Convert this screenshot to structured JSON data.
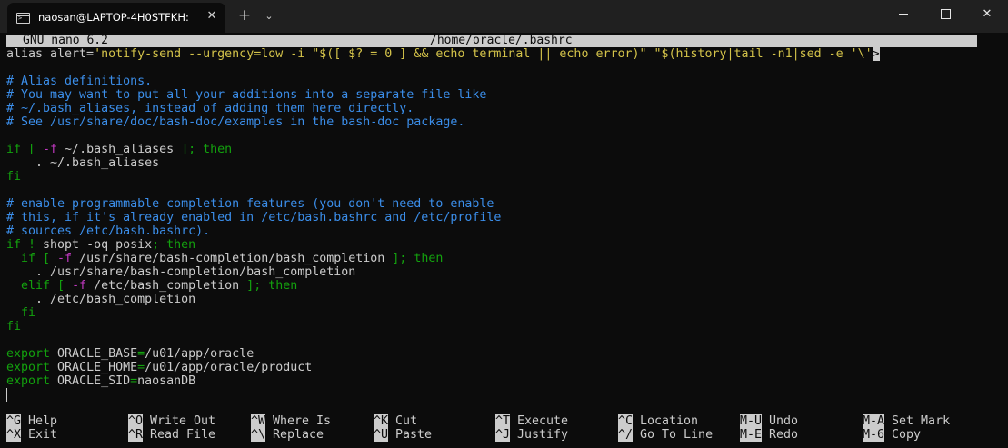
{
  "window": {
    "tab_title": "naosan@LAPTOP-4H0STFKH:",
    "tab_close": "✕",
    "new_tab": "+",
    "dropdown": "⌄",
    "close": "✕"
  },
  "nano": {
    "version": "GNU nano 6.2",
    "file": "/home/oracle/.bashrc",
    "truncation_marker": ">"
  },
  "lines": [
    [
      [
        "w",
        "alias alert="
      ],
      [
        "y",
        "'notify-send --urgency=low -i \"$([ $? = 0 ] && echo terminal || echo error)\" \"$(history|tail -n1|sed -e '\\'"
      ]
    ],
    [],
    [
      [
        "b",
        "# Alias definitions."
      ]
    ],
    [
      [
        "b",
        "# You may want to put all your additions into a separate file like"
      ]
    ],
    [
      [
        "b",
        "# ~/.bash_aliases, instead of adding them here directly."
      ]
    ],
    [
      [
        "b",
        "# See /usr/share/doc/bash-doc/examples in the bash-doc package."
      ]
    ],
    [],
    [
      [
        "g",
        "if [ "
      ],
      [
        "m",
        "-f"
      ],
      [
        "w",
        " ~/.bash_aliases "
      ],
      [
        "g",
        "]; then"
      ]
    ],
    [
      [
        "w",
        "    . ~/.bash_aliases"
      ]
    ],
    [
      [
        "g",
        "fi"
      ]
    ],
    [],
    [
      [
        "b",
        "# enable programmable completion features (you don't need to enable"
      ]
    ],
    [
      [
        "b",
        "# this, if it's already enabled in /etc/bash.bashrc and /etc/profile"
      ]
    ],
    [
      [
        "b",
        "# sources /etc/bash.bashrc)."
      ]
    ],
    [
      [
        "g",
        "if ! "
      ],
      [
        "w",
        "shopt -oq posix"
      ],
      [
        "g",
        "; then"
      ]
    ],
    [
      [
        "g",
        "  if [ "
      ],
      [
        "m",
        "-f"
      ],
      [
        "w",
        " /usr/share/bash-completion/bash_completion "
      ],
      [
        "g",
        "]; then"
      ]
    ],
    [
      [
        "w",
        "    . /usr/share/bash-completion/bash_completion"
      ]
    ],
    [
      [
        "g",
        "  elif [ "
      ],
      [
        "m",
        "-f"
      ],
      [
        "w",
        " /etc/bash_completion "
      ],
      [
        "g",
        "]; then"
      ]
    ],
    [
      [
        "w",
        "    . /etc/bash_completion"
      ]
    ],
    [
      [
        "g",
        "  fi"
      ]
    ],
    [
      [
        "g",
        "fi"
      ]
    ],
    [],
    [
      [
        "g",
        "export "
      ],
      [
        "w",
        "ORACLE_BASE"
      ],
      [
        "g",
        "="
      ],
      [
        "w",
        "/u01/app/oracle"
      ]
    ],
    [
      [
        "g",
        "export "
      ],
      [
        "w",
        "ORACLE_HOME"
      ],
      [
        "g",
        "="
      ],
      [
        "w",
        "/u01/app/oracle/product"
      ]
    ],
    [
      [
        "g",
        "export "
      ],
      [
        "w",
        "ORACLE_SID"
      ],
      [
        "g",
        "="
      ],
      [
        "w",
        "naosanDB"
      ]
    ]
  ],
  "shortcuts": {
    "row1": [
      {
        "key": "^G",
        "label": "Help"
      },
      {
        "key": "^O",
        "label": "Write Out"
      },
      {
        "key": "^W",
        "label": "Where Is"
      },
      {
        "key": "^K",
        "label": "Cut"
      },
      {
        "key": "^T",
        "label": "Execute"
      },
      {
        "key": "^C",
        "label": "Location"
      },
      {
        "key": "M-U",
        "label": "Undo"
      },
      {
        "key": "M-A",
        "label": "Set Mark"
      }
    ],
    "row2": [
      {
        "key": "^X",
        "label": "Exit"
      },
      {
        "key": "^R",
        "label": "Read File"
      },
      {
        "key": "^\\",
        "label": "Replace"
      },
      {
        "key": "^U",
        "label": "Paste"
      },
      {
        "key": "^J",
        "label": "Justify"
      },
      {
        "key": "^/",
        "label": "Go To Line"
      },
      {
        "key": "M-E",
        "label": "Redo"
      },
      {
        "key": "M-6",
        "label": "Copy"
      }
    ]
  }
}
